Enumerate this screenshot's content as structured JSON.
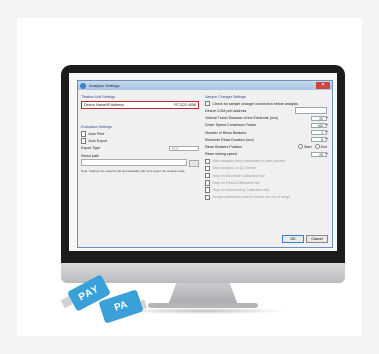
{
  "window": {
    "title": "Analysis Settings"
  },
  "left": {
    "station_header": "Titration Unit Settings",
    "device_label": "Device Name/IP Address",
    "device_value": "RT1222 4058",
    "evaluation_header": "Evaluation Settings",
    "auto_print": "Auto Print",
    "auto_export": "Auto Export",
    "export_type_label": "Export Type",
    "export_type_value": "PDF",
    "select_path": "Select path",
    "browse": "...",
    "note": "Note: Starting the analysis will automatically print and export the analysis data."
  },
  "right": {
    "header": "Sample Changer Settings",
    "check_changes": "Check for sample changer connection before analysis",
    "com_port": "Device COM port address",
    "vertical_travel": "Vertical Travel Distance of the Electrode (mm)",
    "vertical_value": "20",
    "driver_speed": "Driver Speed Conversion Factor",
    "driver_value": "100",
    "rinse_beakers": "Number of Rinse Beakers",
    "rinse_value": "1",
    "rinse_duration": "Electrode Rinse Duration (sec)",
    "rinse_duration_value": "5",
    "rinse_position": "Rinse Beakers Position",
    "start": "Start",
    "end": "End",
    "rinse_stirring": "Rinse stirring speed",
    "stirring_value": "20",
    "opt1": "After analysis keep electrodes in park position",
    "opt2": "Stop analysis on QC failure",
    "opt3": "Stop on Electrode Calibration fail",
    "opt4": "Stop on Titrant Calibration fail",
    "opt5": "Stop on Autoleveling Calibration fail",
    "opt6": "Accept calibration even if results are out of range"
  },
  "buttons": {
    "ok": "OK",
    "cancel": "Cancel"
  },
  "usb": {
    "label1": "PAY",
    "label2": "PA"
  }
}
